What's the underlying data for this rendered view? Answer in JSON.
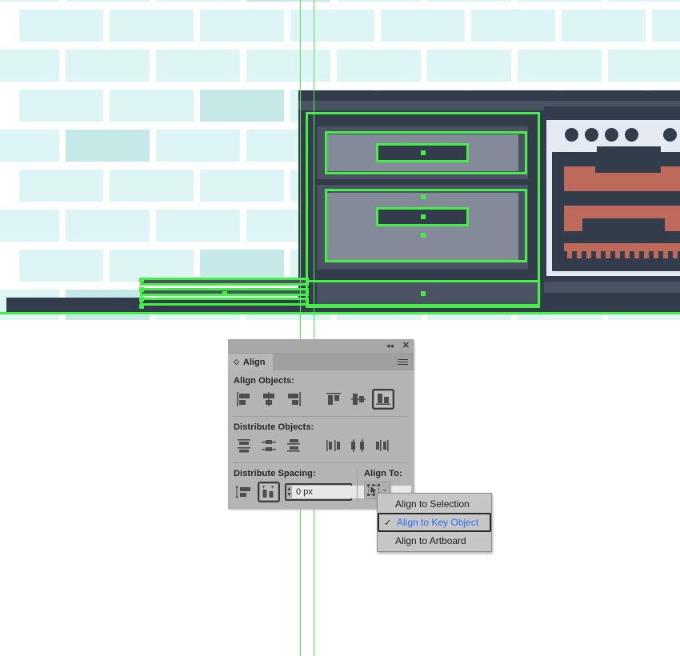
{
  "app": {
    "context": "adobe-illustrator-canvas"
  },
  "colors": {
    "selection_green": "#45f045",
    "tile_light": "#ddf5f4",
    "tile_dark": "#c5e9e6",
    "cabinet_dark": "#333c4a",
    "cabinet_mid": "#4a5263",
    "cabinet_light": "#848a99",
    "oven_white": "#e5e9f2",
    "burner_orange": "#bd6a5a",
    "panel_bg": "#b4b4b4",
    "menu_highlight_text": "#2b6df0"
  },
  "panel": {
    "title": "Align",
    "collapse_icon": "◂◂",
    "close_icon": "✕",
    "tab_icon": "◇",
    "menu_icon": "hamburger-icon",
    "sections": {
      "align_objects": {
        "label": "Align Objects:",
        "buttons": [
          {
            "name": "align-left",
            "selected": false
          },
          {
            "name": "align-horizontal-center",
            "selected": false
          },
          {
            "name": "align-right",
            "selected": false
          },
          {
            "name": "align-top",
            "selected": false
          },
          {
            "name": "align-vertical-center",
            "selected": false
          },
          {
            "name": "align-bottom",
            "selected": true
          }
        ]
      },
      "distribute_objects": {
        "label": "Distribute Objects:",
        "buttons": [
          {
            "name": "distribute-vertical-top",
            "selected": false
          },
          {
            "name": "distribute-vertical-center",
            "selected": false
          },
          {
            "name": "distribute-vertical-bottom",
            "selected": false
          },
          {
            "name": "distribute-horizontal-left",
            "selected": false
          },
          {
            "name": "distribute-horizontal-center",
            "selected": false
          },
          {
            "name": "distribute-horizontal-right",
            "selected": false
          }
        ]
      },
      "distribute_spacing": {
        "label": "Distribute Spacing:",
        "buttons": [
          {
            "name": "vertical-distribute-space",
            "selected": false
          },
          {
            "name": "horizontal-distribute-space",
            "selected": true
          }
        ],
        "spacing_value": "0 px",
        "spacing_placeholder": "0 px"
      },
      "align_to": {
        "label": "Align To:",
        "selected_icon": "align-to-key-object-icon",
        "chevron": "⌄"
      }
    }
  },
  "align_to_menu": {
    "items": [
      {
        "label": "Align to Selection",
        "checked": false,
        "highlighted": false
      },
      {
        "label": "Align to Key Object",
        "checked": true,
        "highlighted": true
      },
      {
        "label": "Align to Artboard",
        "checked": false,
        "highlighted": false
      }
    ],
    "check_glyph": "✓"
  }
}
